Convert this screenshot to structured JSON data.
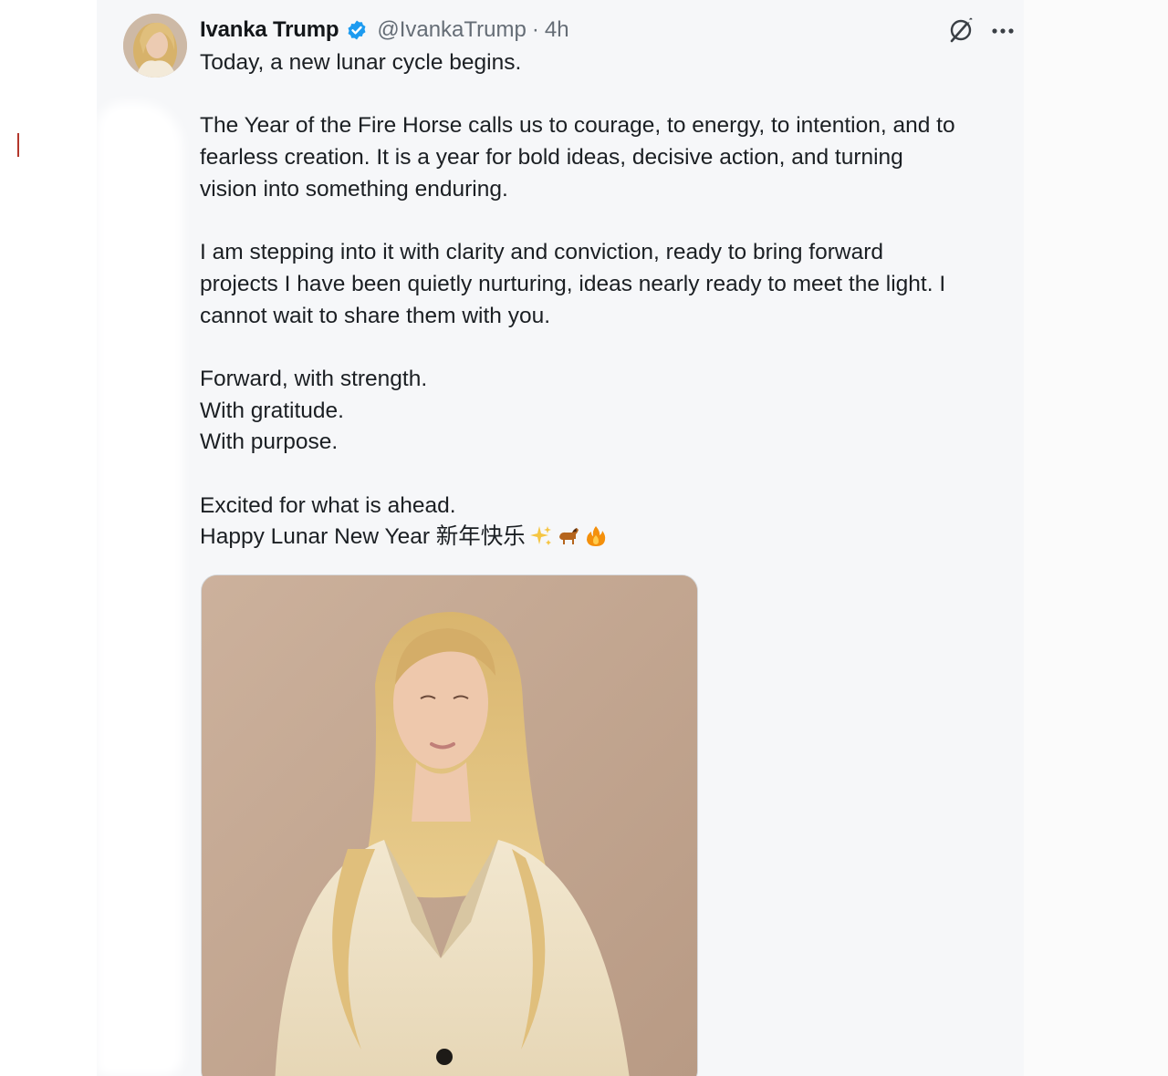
{
  "tweet": {
    "author": {
      "display_name": "Ivanka Trump",
      "handle": "@IvankaTrump",
      "separator": "·",
      "timestamp": "4h",
      "verified_color": "#1d9bf0"
    },
    "body": {
      "p1": [
        "Today, a new lunar cycle begins."
      ],
      "p2": [
        "The Year of the Fire Horse calls us to courage, to energy, to intention, and to",
        "fearless creation. It is a year for bold ideas, decisive action, and turning",
        "vision into something enduring."
      ],
      "p3": [
        "I am stepping into it with clarity and conviction, ready to bring forward",
        "projects I have been quietly nurturing, ideas nearly ready to meet the light. I",
        "cannot wait to share them with you."
      ],
      "p4": [
        "Forward, with strength.",
        "With gratitude.",
        "With purpose."
      ],
      "p5": [
        "Excited for what is ahead.",
        "Happy Lunar New Year 新年快乐"
      ],
      "emojis": [
        "sparkles-emoji",
        "horse-emoji",
        "fire-emoji"
      ]
    },
    "icons": {
      "grok": "grok-icon",
      "more": "more-options-icon"
    },
    "media": {
      "kind": "portrait-photo"
    }
  },
  "colors": {
    "text": "#1b1f23",
    "muted": "#656d76",
    "background": "#f6f7f9",
    "accent": "#1d9bf0"
  }
}
